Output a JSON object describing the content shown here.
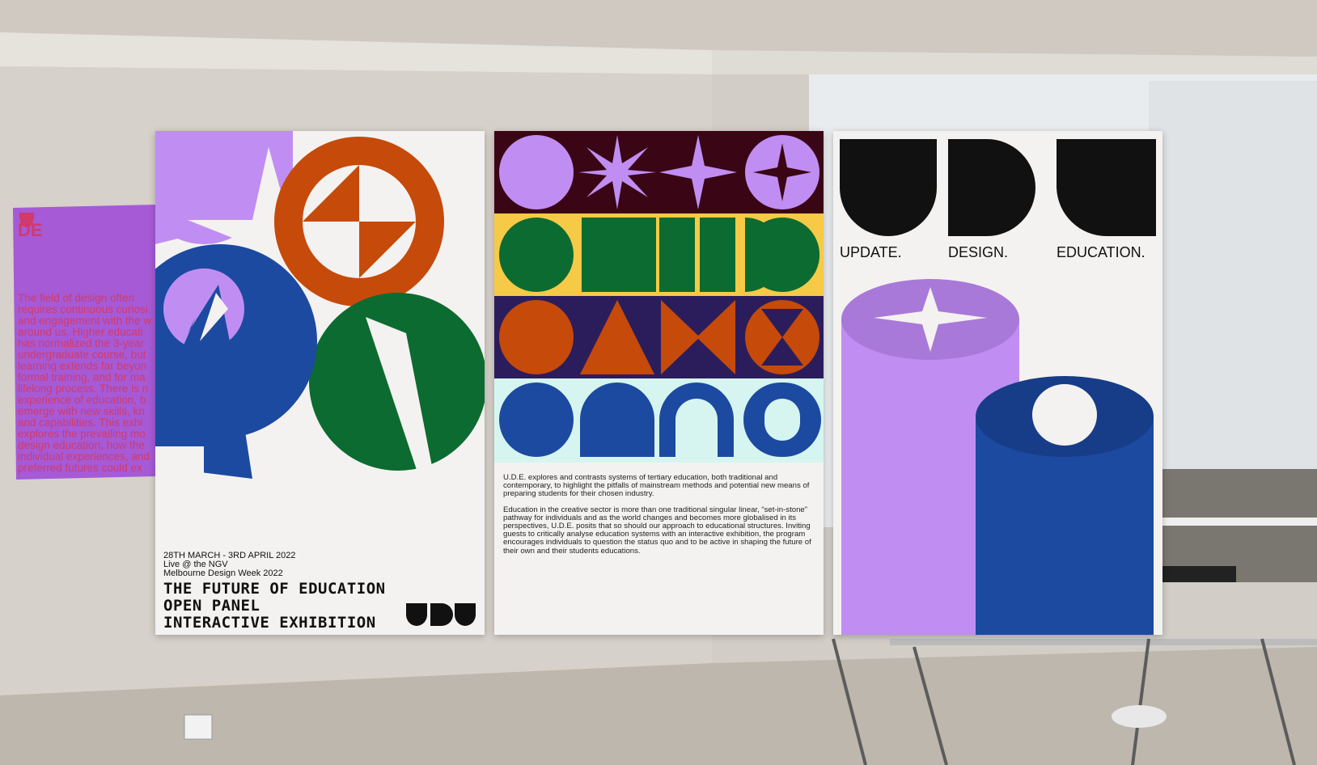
{
  "wall_poster": {
    "logo_text": "DE",
    "body_lines": [
      "The field of design often",
      "requires continuous curiosi",
      "and engagement with the w",
      "around us. Higher educati",
      "has normalized the 3-year",
      "undergraduate course, but",
      "learning extends far beyon",
      "formal training, and for ma",
      "lifelong process. There is n",
      "experience of education, b",
      "emerge with new skills, kn",
      "and capabilities. This exhi",
      "explores the prevailing mo",
      "design education, how the",
      "individual experiences, and",
      "preferred futures could ex"
    ]
  },
  "poster1": {
    "date_line": "28TH MARCH - 3RD APRIL 2022",
    "venue_line": "Live @ the NGV",
    "event_line": "Melbourne Design Week 2022",
    "title_lines": [
      "THE FUTURE OF EDUCATION",
      "OPEN PANEL",
      "INTERACTIVE EXHIBITION"
    ]
  },
  "poster2": {
    "paragraph1": "U.D.E. explores and contrasts systems of tertiary education, both traditional and contemporary, to highlight the pitfalls of mainstream methods and potential new means of preparing students for their chosen industry.",
    "paragraph2": "Education in the creative sector is more than one traditional singular linear, “set-in-stone” pathway for individuals and as the world changes and becomes more globalised in its perspectives, U.D.E. posits that so should our approach to educational structures. Inviting guests to critically analyse education systems with an interactive exhibition, the program encourages individuals to question the status quo and to be active in shaping the future of their own and their students educations."
  },
  "poster3": {
    "word1": "UPDATE.",
    "word2": "DESIGN.",
    "word3": "EDUCATION."
  },
  "colors": {
    "lilac": "#c08ef2",
    "orange": "#c64a0a",
    "green": "#0c6b30",
    "blue": "#1c4aa0",
    "maroon": "#3a0515",
    "yellow": "#f6ca47",
    "navy": "#2b1d5c",
    "mint": "#d6f5f0",
    "wall_poster": "#a65ad6",
    "wall_text": "#d13a6b"
  }
}
